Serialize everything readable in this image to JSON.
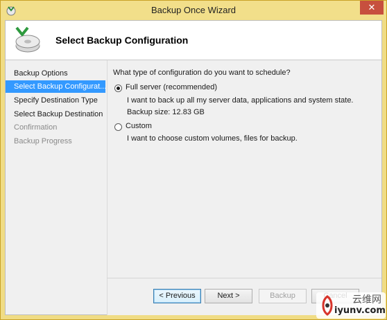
{
  "window": {
    "title": "Backup Once Wizard",
    "close_glyph": "✕"
  },
  "header": {
    "title": "Select Backup Configuration",
    "icon": "backup-disk-icon"
  },
  "nav": {
    "items": [
      {
        "label": "Backup Options",
        "state": "normal"
      },
      {
        "label": "Select Backup Configurat...",
        "state": "selected"
      },
      {
        "label": "Specify Destination Type",
        "state": "normal"
      },
      {
        "label": "Select Backup Destination",
        "state": "normal"
      },
      {
        "label": "Confirmation",
        "state": "disabled"
      },
      {
        "label": "Backup Progress",
        "state": "disabled"
      }
    ]
  },
  "content": {
    "question": "What type of configuration do you want to schedule?",
    "options": [
      {
        "label": "Full server (recommended)",
        "selected": true,
        "description": "I want to back up all my server data, applications and system state.",
        "detail": "Backup size: 12.83 GB"
      },
      {
        "label": "Custom",
        "selected": false,
        "description": "I want to choose custom volumes, files for backup."
      }
    ]
  },
  "buttons": {
    "previous": "< Previous",
    "next": "Next >",
    "backup": "Backup",
    "cancel": "Cancel"
  },
  "watermark": {
    "url": "iyunv.com",
    "brand_cn": "云维网"
  },
  "colors": {
    "title_bar": "#f2df8a",
    "selection": "#3399ff",
    "close_button": "#c7503e"
  }
}
